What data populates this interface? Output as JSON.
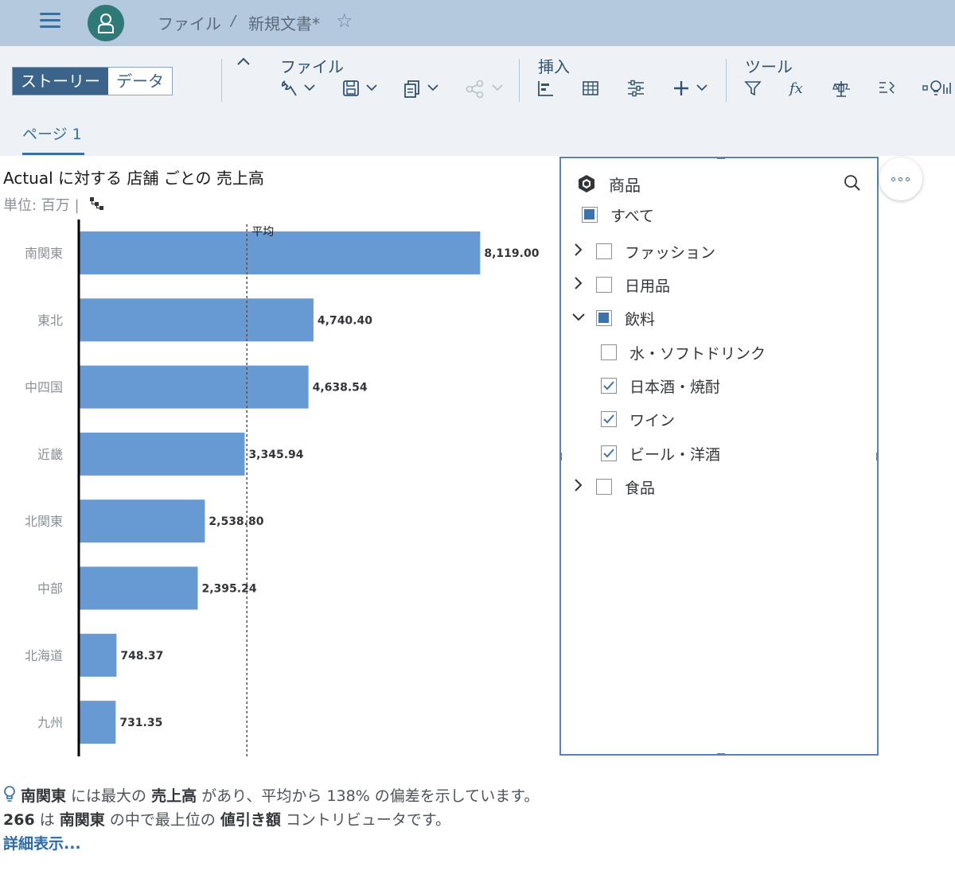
{
  "shell": {
    "breadcrumb_file": "ファイル",
    "breadcrumb_sep": "/",
    "breadcrumb_doc": "新規文書*",
    "star": "☆"
  },
  "toolbar": {
    "story_label": "ストーリー",
    "data_label": "データ",
    "group_file": "ファイル",
    "group_insert": "挿入",
    "group_tools": "ツール",
    "page_tab": "ページ 1"
  },
  "chart_data": {
    "type": "bar",
    "orientation": "horizontal",
    "title": "Actual に対する 店舗 ごとの 売上高",
    "subtitle": "単位: 百万",
    "categories": [
      "南関東",
      "東北",
      "中四国",
      "近畿",
      "北関東",
      "中部",
      "北海道",
      "九州"
    ],
    "values": [
      8119.0,
      4740.4,
      4638.54,
      3345.94,
      2538.8,
      2395.24,
      748.37,
      731.35
    ],
    "value_labels": [
      "8,119.00",
      "4,740.40",
      "4,638.54",
      "3,345.94",
      "2,538.80",
      "2,395.24",
      "748.37",
      "731.35"
    ],
    "reference_line": {
      "label": "平均",
      "value": 3407.2
    },
    "xlim": [
      0,
      10000
    ],
    "bar_color": "#6799d3",
    "grid": false
  },
  "insight": {
    "p1": "南関東",
    "p2": " には最大の ",
    "p3": "売上高",
    "p4": " があり、平均から 138% の偏差を示しています。",
    "p5": "266",
    "p6": " は ",
    "p7": "南関東",
    "p8": " の中で最上位の ",
    "p9": "値引き額",
    "p10": " コントリビュータです。",
    "more": "詳細表示..."
  },
  "filter": {
    "title": "商品",
    "items": [
      {
        "label": "すべて",
        "state": "partial",
        "chevron": "none"
      },
      {
        "label": "ファッション",
        "state": "unchecked",
        "chevron": "right"
      },
      {
        "label": "日用品",
        "state": "unchecked",
        "chevron": "right"
      },
      {
        "label": "飲料",
        "state": "partial",
        "chevron": "down"
      },
      {
        "label": "水・ソフトドリンク",
        "state": "unchecked",
        "chevron": "none"
      },
      {
        "label": "日本酒・焼酎",
        "state": "checked",
        "chevron": "none"
      },
      {
        "label": "ワイン",
        "state": "checked",
        "chevron": "none"
      },
      {
        "label": "ビール・洋酒",
        "state": "checked",
        "chevron": "none"
      },
      {
        "label": "食品",
        "state": "unchecked",
        "chevron": "right"
      }
    ]
  },
  "colors": {
    "accent": "#3c6389",
    "bar": "#6799d3",
    "link": "#2d6ba9",
    "check": "#3d73ad"
  }
}
